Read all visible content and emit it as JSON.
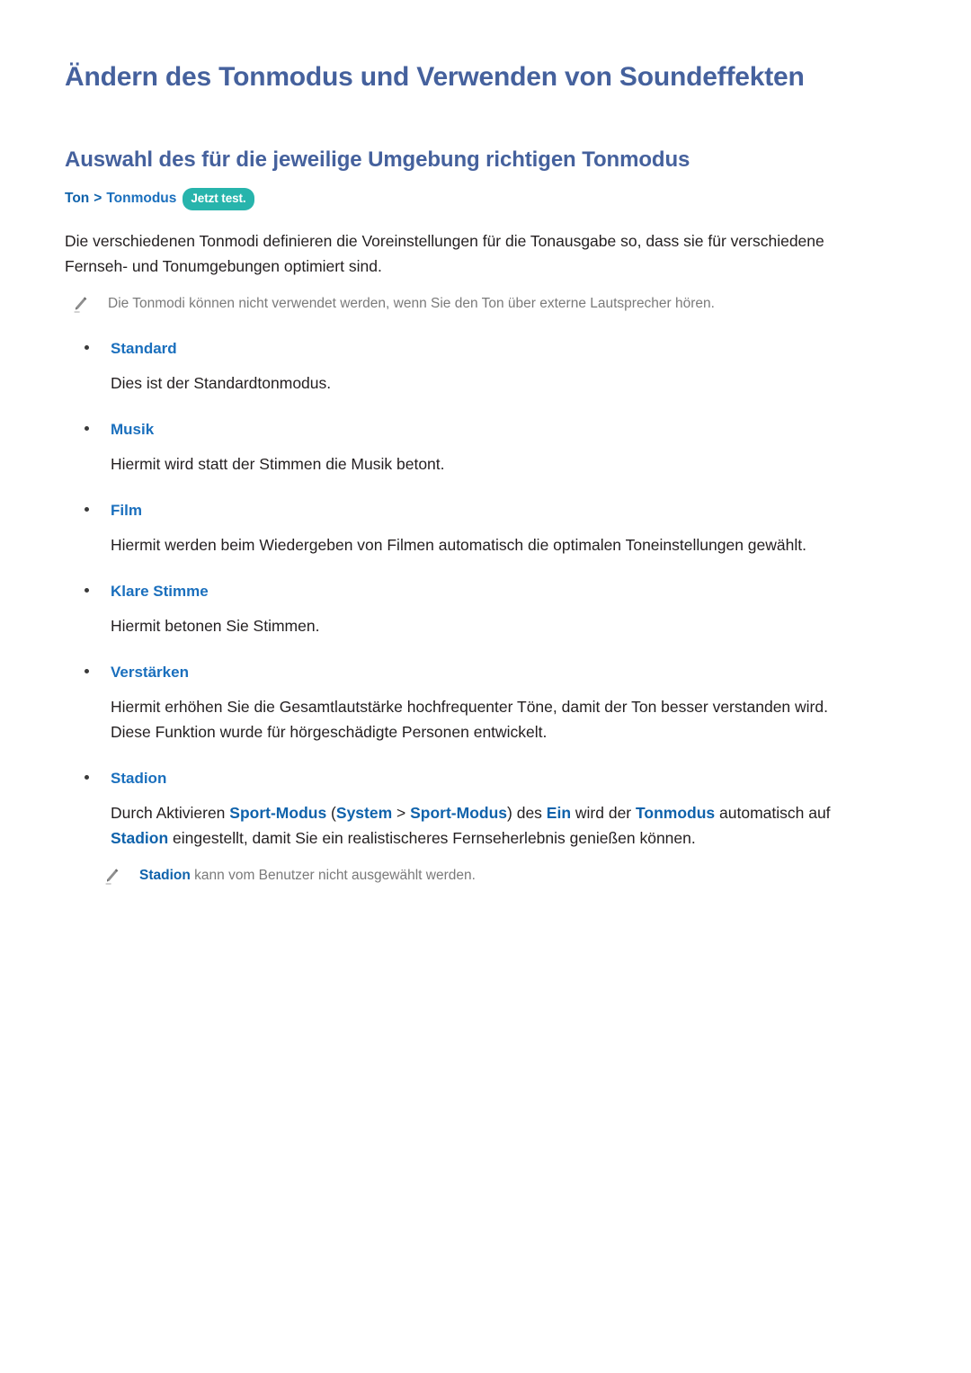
{
  "document": {
    "title": "Ändern des Tonmodus und Verwenden von Soundeffekten",
    "section_title": "Auswahl des für die jeweilige Umgebung richtigen Tonmodus"
  },
  "colors": {
    "heading_blue": "#45619d",
    "link_blue": "#0f62ab",
    "mode_blue": "#1a6fbd",
    "badge_teal": "#27b4ac",
    "body_text": "#231f20",
    "note_text": "#7a7a7a",
    "background": "#ffffff"
  },
  "breadcrumb": {
    "items": [
      "Ton",
      "Tonmodus"
    ],
    "separator": ">",
    "badge": "Jetzt test."
  },
  "intro": {
    "paragraph": "Die verschiedenen Tonmodi definieren die Voreinstellungen für die Tonausgabe so,  dass sie für verschiedene Fernseh- und Tonumgebungen optimiert sind.",
    "note": "Die Tonmodi können nicht verwendet werden, wenn Sie den Ton über externe Lautsprecher hören."
  },
  "modes": [
    {
      "name": "Standard",
      "description": "Dies ist der Standardtonmodus."
    },
    {
      "name": "Musik",
      "description": "Hiermit wird statt der Stimmen die Musik betont."
    },
    {
      "name": "Film",
      "description": "Hiermit werden beim Wiedergeben von Filmen automatisch die optimalen Toneinstellungen gewählt."
    },
    {
      "name": "Klare Stimme",
      "description": "Hiermit betonen Sie Stimmen."
    },
    {
      "name": "Verstärken",
      "description": "Hiermit erhöhen Sie die Gesamtlautstärke hochfrequenter Töne, damit der Ton besser verstanden wird. Diese Funktion wurde für hörgeschädigte Personen entwickelt."
    },
    {
      "name": "Stadion",
      "description_parts": {
        "p1": "Durch Aktivieren ",
        "b1": "Sport-Modus",
        "p2": " (",
        "b2": "System",
        "p3": " > ",
        "b3": "Sport-Modus",
        "p4": ") des ",
        "b4": "Ein",
        "p5": " wird der ",
        "b5": "Tonmodus",
        "p6": " automatisch auf ",
        "b6": "Stadion",
        "p7": " eingestellt, damit Sie ein realistischeres Fernseherlebnis genießen können."
      },
      "note_parts": {
        "b1": "Stadion",
        "p1": " kann vom Benutzer nicht ausgewählt werden."
      }
    }
  ],
  "icons": {
    "pencil": "pencil-icon",
    "bullet": "bullet-dot"
  }
}
